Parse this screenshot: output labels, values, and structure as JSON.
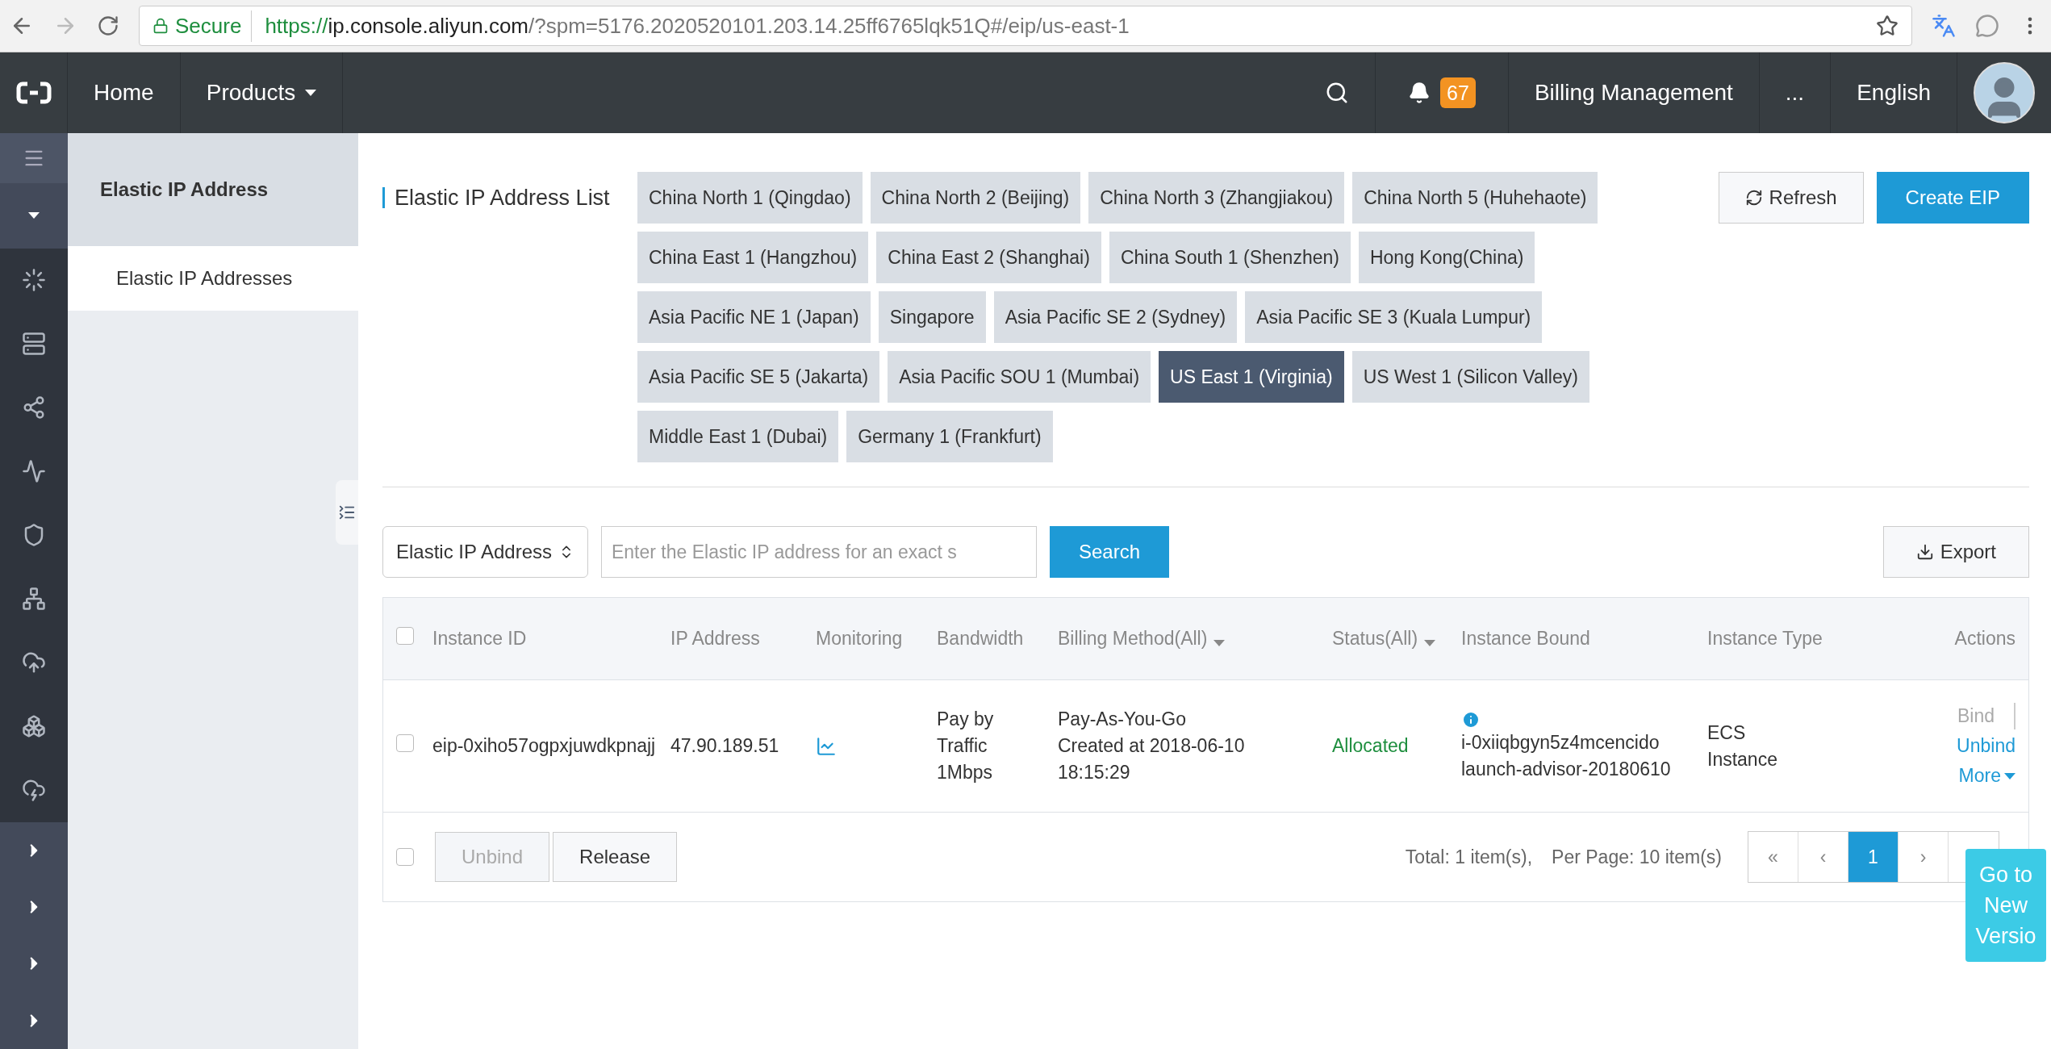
{
  "browser": {
    "secure_label": "Secure",
    "url_scheme": "https://",
    "url_host": "ip.console.aliyun.com",
    "url_path": "/?spm=5176.2020520101.203.14.25ff6765lqk51Q#/eip/us-east-1"
  },
  "nav": {
    "items": [
      {
        "label": "Home",
        "dropdown": false
      },
      {
        "label": "Products",
        "dropdown": true
      }
    ],
    "notification_count": "67",
    "right_items": [
      "Billing Management",
      "...",
      "English"
    ]
  },
  "sidebar": {
    "title": "Elastic IP Address",
    "items": [
      {
        "label": "Elastic IP Addresses",
        "selected": true
      }
    ]
  },
  "page": {
    "title": "Elastic IP Address List",
    "regions": [
      {
        "label": "China North 1 (Qingdao)",
        "selected": false
      },
      {
        "label": "China North 2 (Beijing)",
        "selected": false
      },
      {
        "label": "China North 3 (Zhangjiakou)",
        "selected": false
      },
      {
        "label": "China North 5 (Huhehaote)",
        "selected": false
      },
      {
        "label": "China East 1 (Hangzhou)",
        "selected": false
      },
      {
        "label": "China East 2 (Shanghai)",
        "selected": false
      },
      {
        "label": "China South 1 (Shenzhen)",
        "selected": false
      },
      {
        "label": "Hong Kong(China)",
        "selected": false
      },
      {
        "label": "Asia Pacific NE 1 (Japan)",
        "selected": false
      },
      {
        "label": "Singapore",
        "selected": false
      },
      {
        "label": "Asia Pacific SE 2 (Sydney)",
        "selected": false
      },
      {
        "label": "Asia Pacific SE 3 (Kuala Lumpur)",
        "selected": false
      },
      {
        "label": "Asia Pacific SE 5 (Jakarta)",
        "selected": false
      },
      {
        "label": "Asia Pacific SOU 1 (Mumbai)",
        "selected": false
      },
      {
        "label": "US East 1 (Virginia)",
        "selected": true
      },
      {
        "label": "US West 1 (Silicon Valley)",
        "selected": false
      },
      {
        "label": "Middle East 1 (Dubai)",
        "selected": false
      },
      {
        "label": "Germany 1 (Frankfurt)",
        "selected": false
      }
    ],
    "refresh_label": "Refresh",
    "create_label": "Create EIP"
  },
  "search": {
    "filter": "Elastic IP Address",
    "placeholder": "Enter the Elastic IP address for an exact s",
    "button": "Search",
    "export": "Export"
  },
  "table": {
    "select_all_checked": false,
    "columns": [
      {
        "label": "Instance ID",
        "filter": false
      },
      {
        "label": "IP Address",
        "filter": false
      },
      {
        "label": "Monitoring",
        "filter": false
      },
      {
        "label": "Bandwidth",
        "filter": false
      },
      {
        "label": "Billing Method(All)",
        "filter": true
      },
      {
        "label": "Status(All)",
        "filter": true
      },
      {
        "label": "Instance Bound",
        "filter": false
      },
      {
        "label": "Instance Type",
        "filter": false
      },
      {
        "label": "Actions",
        "filter": false
      }
    ],
    "rows": [
      {
        "checked": false,
        "instance_id": "eip-0xiho57ogpxjuwdkpnajj",
        "ip": "47.90.189.51",
        "bandwidth": [
          "Pay by",
          "Traffic",
          "1Mbps"
        ],
        "billing": [
          "Pay-As-You-Go",
          "Created at 2018-06-10",
          "18:15:29"
        ],
        "status": {
          "label": "Allocated",
          "kind": "allocated"
        },
        "instance_bound": [
          "i-0xiiqbgyn5z4mcencido",
          "launch-advisor-20180610"
        ],
        "instance_type": [
          "ECS",
          "Instance"
        ],
        "actions": [
          {
            "label": "Bind",
            "disabled": true,
            "dropdown": false
          },
          {
            "label": "Unbind",
            "disabled": false,
            "dropdown": false
          },
          {
            "label": "More",
            "disabled": false,
            "dropdown": true
          }
        ]
      }
    ]
  },
  "footer": {
    "checked": false,
    "buttons": [
      {
        "label": "Unbind",
        "disabled": true
      },
      {
        "label": "Release",
        "disabled": false
      }
    ],
    "total": "Total: 1 item(s),",
    "per_page": "Per Page: 10 item(s)",
    "pages": [
      {
        "label": "«",
        "selected": false
      },
      {
        "label": "‹",
        "selected": false
      },
      {
        "label": "1",
        "selected": true
      },
      {
        "label": "›",
        "selected": false
      }
    ]
  },
  "new_version": "Go to New Versio"
}
